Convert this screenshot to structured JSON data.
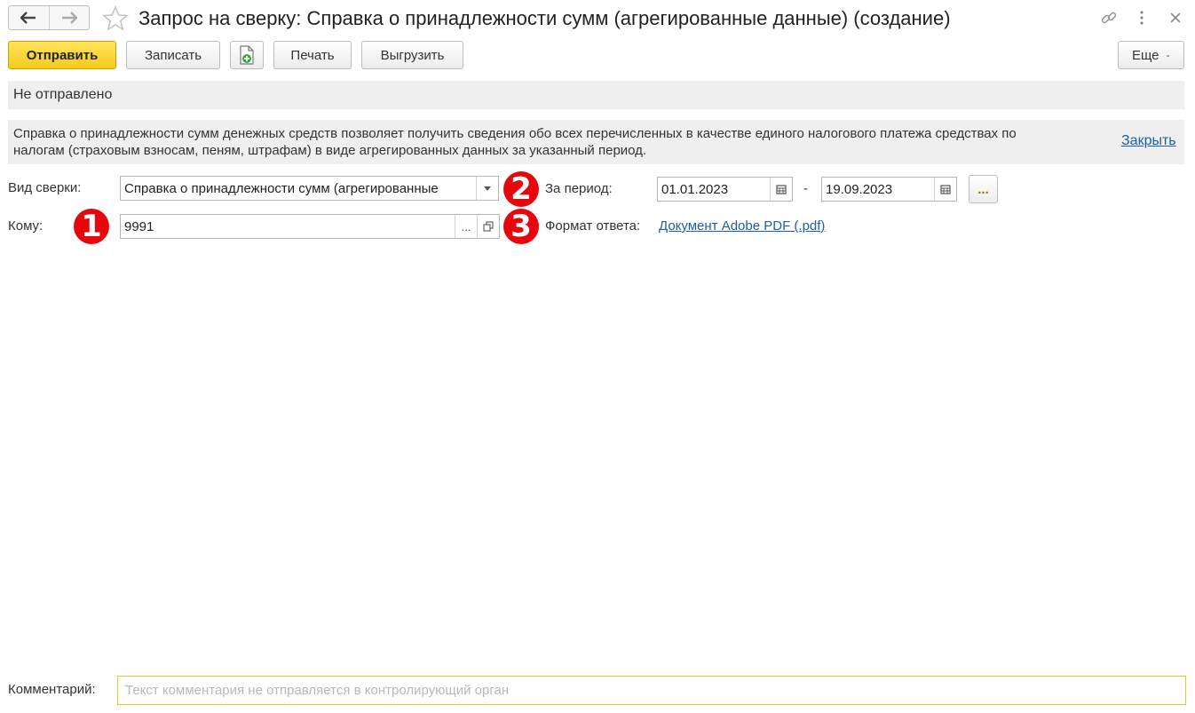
{
  "window": {
    "title": "Запрос на сверку: Справка о принадлежности сумм (агрегированные данные) (создание)",
    "icons": [
      "back-arrow-icon",
      "forward-arrow-icon",
      "favorite-star-icon",
      "link-icon",
      "more-vertical-icon",
      "close-icon"
    ]
  },
  "toolbar": {
    "send_label": "Отправить",
    "save_label": "Записать",
    "print_label": "Печать",
    "export_label": "Выгрузить",
    "more_label": "Еще",
    "more_caret": "-"
  },
  "status": {
    "text": "Не отправлено"
  },
  "info": {
    "text": "Справка о принадлежности сумм денежных средств позволяет получить сведения обо всех перечисленных в качестве единого налогового платежа средствах по налогам (страховым взносам, пеням, штрафам) в виде агрегированных данных за указанный период.",
    "close_label": "Закрыть"
  },
  "form": {
    "type_label": "Вид сверки:",
    "type_value": "Справка о принадлежности сумм (агрегированные",
    "to_label": "Кому:",
    "to_value": "9991",
    "to_select_button": "...",
    "period_label": "За период:",
    "period_from": "01.01.2023",
    "period_dash": "-",
    "period_to": "19.09.2023",
    "period_button": "...",
    "format_label": "Формат ответа:",
    "format_value": "Документ Adobe PDF (.pdf)"
  },
  "badges": [
    "1",
    "2",
    "3"
  ],
  "comment": {
    "label": "Комментарий:",
    "placeholder": "Текст комментария не отправляется в контролирующий орган",
    "value": ""
  },
  "colors": {
    "primary_button": "#f4cb1a",
    "badge": "#e8060d",
    "link": "#1c5fa8",
    "comment_border": "#e8c533"
  }
}
